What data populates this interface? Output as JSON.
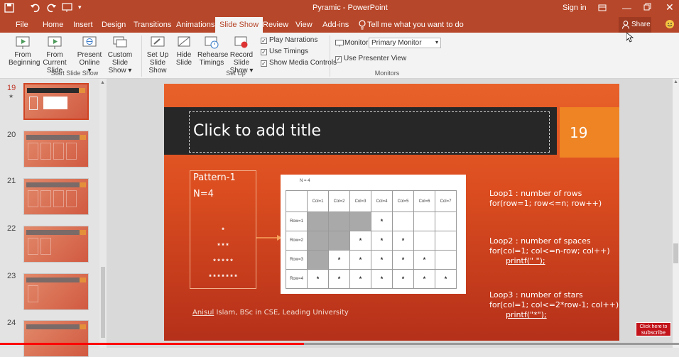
{
  "titlebar": {
    "center_title": "Pyramic  -  PowerPoint",
    "signin": "Sign in",
    "qat_icons": [
      "save-icon",
      "undo-icon",
      "redo-icon",
      "present-from-beginning-icon",
      "customize-qat-icon"
    ]
  },
  "tabs": [
    {
      "label": "File"
    },
    {
      "label": "Home"
    },
    {
      "label": "Insert"
    },
    {
      "label": "Design"
    },
    {
      "label": "Transitions"
    },
    {
      "label": "Animations"
    },
    {
      "label": "Slide Show"
    },
    {
      "label": "Review"
    },
    {
      "label": "View"
    },
    {
      "label": "Add-ins"
    }
  ],
  "tellme": "Tell me what you want to do",
  "share": "Share",
  "ribbon": {
    "start": {
      "from_beginning": [
        "From",
        "Beginning"
      ],
      "from_current": [
        "From",
        "Current Slide"
      ],
      "present_online": [
        "Present",
        "Online ▾"
      ],
      "custom_show": [
        "Custom Slide",
        "Show ▾"
      ],
      "group_label": "Start Slide Show"
    },
    "setup": {
      "setup_show": [
        "Set Up",
        "Slide Show"
      ],
      "hide_slide": [
        "Hide",
        "Slide"
      ],
      "rehearse": [
        "Rehearse",
        "Timings"
      ],
      "record": [
        "Record Slide",
        "Show ▾"
      ],
      "play_narrations": "Play Narrations",
      "use_timings": "Use Timings",
      "show_media_controls": "Show Media Controls",
      "group_label": "Set Up"
    },
    "monitors": {
      "monitor_label": "Monitor:",
      "monitor_value": "Primary Monitor",
      "use_presenter_view": "Use Presenter View",
      "group_label": "Monitors"
    }
  },
  "thumbnails": [
    {
      "num": "19",
      "selected": true
    },
    {
      "num": "20",
      "title": "Pattern Type 8"
    },
    {
      "num": "21",
      "title": "Pattern Type 9"
    },
    {
      "num": "22",
      "title": "Pattern Type 10"
    },
    {
      "num": "23",
      "title": "Pattern Type 11"
    },
    {
      "num": "24",
      "title": "Pattern Type 11"
    }
  ],
  "slide": {
    "title_placeholder": "Click to add title",
    "slide_number": "19",
    "pattern_title": "Pattern-1",
    "n_label": "N=4",
    "pyramid": [
      "*",
      "* * *",
      "* * * * *",
      "* * * * * * *"
    ],
    "table": {
      "caption": "N = 4",
      "col_headers": [
        "Col=1",
        "Col=2",
        "Col=3",
        "Col=4",
        "Col=5",
        "Col=6",
        "Col=7"
      ],
      "rows": [
        {
          "label": "Row=1",
          "cells": [
            "",
            "",
            "",
            "*",
            "",
            "",
            ""
          ]
        },
        {
          "label": "Row=2",
          "cells": [
            "",
            "",
            "*",
            "*",
            "*",
            "",
            ""
          ]
        },
        {
          "label": "Row=3",
          "cells": [
            "",
            "*",
            "*",
            "*",
            "*",
            "*",
            ""
          ]
        },
        {
          "label": "Row=4",
          "cells": [
            "*",
            "*",
            "*",
            "*",
            "*",
            "*",
            "*"
          ]
        }
      ]
    },
    "loop1": [
      "Loop1 : number of rows",
      "for(row=1; row<=n; row++)"
    ],
    "loop2": [
      "Loop2 : number of spaces",
      "for(col=1; col<=n-row; col++)",
      "printf(\" \");"
    ],
    "loop3": [
      "Loop3 : number of stars",
      "for(col=1; col<=2*row-1; col++)",
      "printf(\"*\");"
    ],
    "footer_name": "Anisul",
    "footer_rest": " Islam, BSc in CSE, Leading University"
  },
  "subscribe": [
    "Click here to",
    "subscribe"
  ],
  "video_progress": 0.448
}
